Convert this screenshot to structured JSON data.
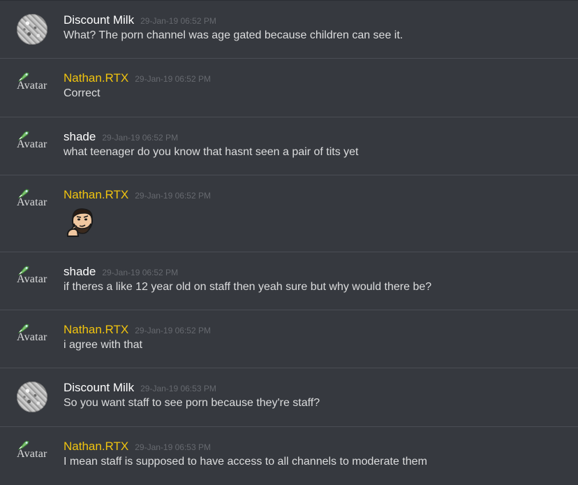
{
  "colors": {
    "background": "#36393f",
    "divider": "#4a4d54",
    "username_default": "#ffffff",
    "username_highlight": "#f1c40f",
    "timestamp": "#66696f",
    "message_text": "#dcddde"
  },
  "messages": [
    {
      "author": "Discount Milk",
      "timestamp": "29-Jan-19 06:52 PM",
      "text": "What? The porn channel was age gated because children can see it.",
      "avatar": "image"
    },
    {
      "author": "Nathan.RTX",
      "timestamp": "29-Jan-19 06:52 PM",
      "text": "Correct",
      "avatar": "broken",
      "avatar_alt": "Avatar"
    },
    {
      "author": "shade",
      "timestamp": "29-Jan-19 06:52 PM",
      "text": "what teenager do you know that hasnt seen a pair of tits yet",
      "avatar": "broken",
      "avatar_alt": "Avatar"
    },
    {
      "author": "Nathan.RTX",
      "timestamp": "29-Jan-19 06:52 PM",
      "text": "",
      "avatar": "broken",
      "avatar_alt": "Avatar",
      "attachment": "custom-emoji"
    },
    {
      "author": "shade",
      "timestamp": "29-Jan-19 06:52 PM",
      "text": "if theres a like 12 year old on staff then yeah sure but why would there be?",
      "avatar": "broken",
      "avatar_alt": "Avatar"
    },
    {
      "author": "Nathan.RTX",
      "timestamp": "29-Jan-19 06:52 PM",
      "text": "i agree with that",
      "avatar": "broken",
      "avatar_alt": "Avatar"
    },
    {
      "author": "Discount Milk",
      "timestamp": "29-Jan-19 06:53 PM",
      "text": "So you want staff to see porn because they're staff?",
      "avatar": "image"
    },
    {
      "author": "Nathan.RTX",
      "timestamp": "29-Jan-19 06:53 PM",
      "text": "I mean staff is supposed to have access to all channels to moderate them",
      "avatar": "broken",
      "avatar_alt": "Avatar"
    }
  ]
}
